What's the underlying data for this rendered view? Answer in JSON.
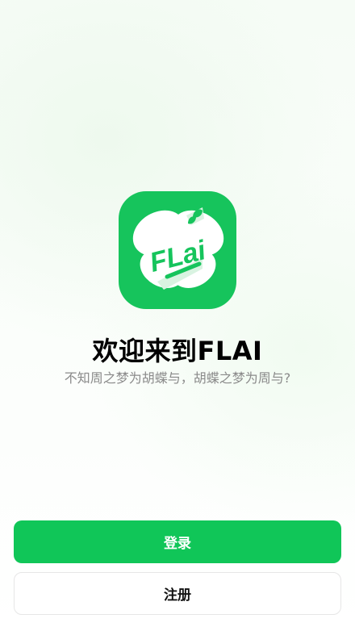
{
  "app": {
    "logo_icon": "butterfly-flai-logo-icon",
    "logo_text": "FLai",
    "brand_color": "#16C45C"
  },
  "welcome": {
    "title": "欢迎来到FLAI",
    "subtitle": "不知周之梦为胡蝶与，胡蝶之梦为周与?"
  },
  "actions": {
    "login_label": "登录",
    "register_label": "注册",
    "login_color": "#10C658"
  }
}
